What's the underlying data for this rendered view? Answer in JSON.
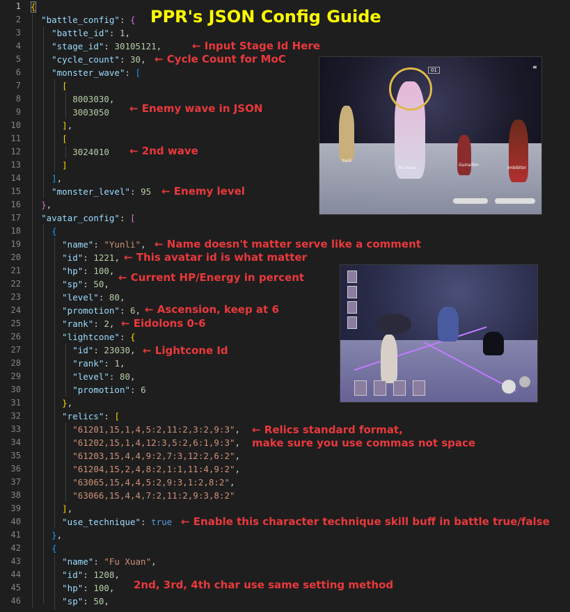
{
  "title": "PPR's JSON Config Guide",
  "line_numbers": [
    "1",
    "2",
    "3",
    "4",
    "5",
    "6",
    "7",
    "8",
    "9",
    "10",
    "11",
    "12",
    "13",
    "14",
    "15",
    "16",
    "17",
    "18",
    "19",
    "20",
    "21",
    "22",
    "23",
    "24",
    "25",
    "26",
    "27",
    "28",
    "29",
    "30",
    "31",
    "32",
    "33",
    "34",
    "35",
    "36",
    "37",
    "38",
    "39",
    "40",
    "41",
    "42",
    "43",
    "44",
    "45",
    "46"
  ],
  "code": {
    "battle_config_key": "\"battle_config\"",
    "battle_id_key": "\"battle_id\"",
    "battle_id_val": "1",
    "stage_id_key": "\"stage_id\"",
    "stage_id_val": "30105121",
    "cycle_count_key": "\"cycle_count\"",
    "cycle_count_val": "30",
    "monster_wave_key": "\"monster_wave\"",
    "wave1_a": "8003030",
    "wave1_b": "3003050",
    "wave2_a": "3024010",
    "monster_level_key": "\"monster_level\"",
    "monster_level_val": "95",
    "avatar_config_key": "\"avatar_config\"",
    "name_key": "\"name\"",
    "name_val": "\"Yunli\"",
    "id_key": "\"id\"",
    "id_val": "1221",
    "hp_key": "\"hp\"",
    "hp_val": "100",
    "sp_key": "\"sp\"",
    "sp_val": "50",
    "level_key": "\"level\"",
    "level_val": "80",
    "promotion_key": "\"promotion\"",
    "promotion_val": "6",
    "rank_key": "\"rank\"",
    "rank_val": "2",
    "lightcone_key": "\"lightcone\"",
    "lc_id_val": "23030",
    "lc_rank_val": "1",
    "lc_level_val": "80",
    "lc_promotion_val": "6",
    "relics_key": "\"relics\"",
    "relics": [
      "\"61201,15,1,4,5:2,11:2,3:2,9:3\"",
      "\"61202,15,1,4,12:3,5:2,6:1,9:3\"",
      "\"61203,15,4,4,9:2,7:3,12:2,6:2\"",
      "\"61204,15,2,4,8:2,1:1,11:4,9:2\"",
      "\"63065,15,4,4,5:2,9:3,1:2,8:2\"",
      "\"63066,15,4,4,7:2,11:2,9:3,8:2\""
    ],
    "use_technique_key": "\"use_technique\"",
    "use_technique_val": "true",
    "name2_val": "\"Fu Xuan\"",
    "id2_val": "1208",
    "hp2_val": "100",
    "sp2_val": "50"
  },
  "notes": {
    "stage": "← Input Stage Id Here",
    "cycle": "← Cycle Count for MoC",
    "wave": "← Enemy wave in JSON",
    "wave2": "← 2nd wave",
    "level": "← Enemy level",
    "name": "← Name doesn't matter serve like a comment",
    "id": "← This avatar id is what matter",
    "hp": "← Current HP/Energy in percent",
    "promotion": "← Ascension, keep at 6",
    "rank": "← Eidolons 0-6",
    "lightcone": "← Lightcone Id",
    "relics1": "← Relics standard format,",
    "relics2": "make sure you use commas not space",
    "technique": "← Enable this character technique skill buff in battle true/false",
    "others": "2nd, 3rd, 4th char use same setting method"
  },
  "screenshot1": {
    "stage_label": "01",
    "chars": [
      "Yunli",
      "Fu Xuan",
      "Guinaifen",
      "Imbibitor"
    ]
  }
}
